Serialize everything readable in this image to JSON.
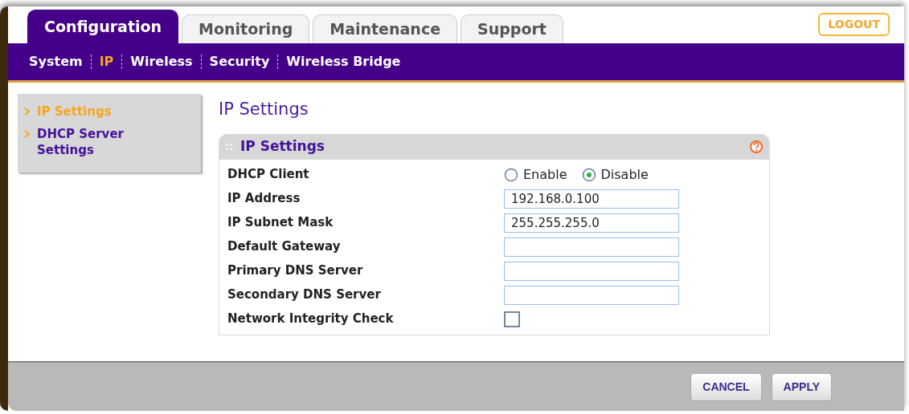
{
  "tabs": [
    {
      "label": "Configuration",
      "selected": true
    },
    {
      "label": "Monitoring",
      "selected": false
    },
    {
      "label": "Maintenance",
      "selected": false
    },
    {
      "label": "Support",
      "selected": false
    }
  ],
  "logout": "LOGOUT",
  "subnav": [
    {
      "label": "System",
      "selected": false
    },
    {
      "label": "IP",
      "selected": true
    },
    {
      "label": "Wireless",
      "selected": false
    },
    {
      "label": "Security",
      "selected": false
    },
    {
      "label": "Wireless Bridge",
      "selected": false
    }
  ],
  "sidebar": {
    "items": [
      {
        "label": "IP Settings",
        "selected": true
      },
      {
        "label": "DHCP Server Settings",
        "selected": false
      }
    ]
  },
  "page_title": "IP Settings",
  "panel": {
    "title": "IP Settings",
    "rows": [
      {
        "kind": "radio",
        "label": "DHCP Client",
        "options": [
          {
            "label": "Enable",
            "selected": false
          },
          {
            "label": "Disable",
            "selected": true
          }
        ]
      },
      {
        "kind": "text",
        "label": "IP Address",
        "value": "192.168.0.100"
      },
      {
        "kind": "text",
        "label": "IP Subnet Mask",
        "value": "255.255.255.0"
      },
      {
        "kind": "text",
        "label": "Default Gateway"
      },
      {
        "kind": "text",
        "label": "Primary DNS Server"
      },
      {
        "kind": "text",
        "label": "Secondary DNS Server"
      },
      {
        "kind": "checkbox",
        "label": "Network Integrity Check",
        "checked": false
      }
    ]
  },
  "buttons": [
    "CANCEL",
    "APPLY"
  ]
}
